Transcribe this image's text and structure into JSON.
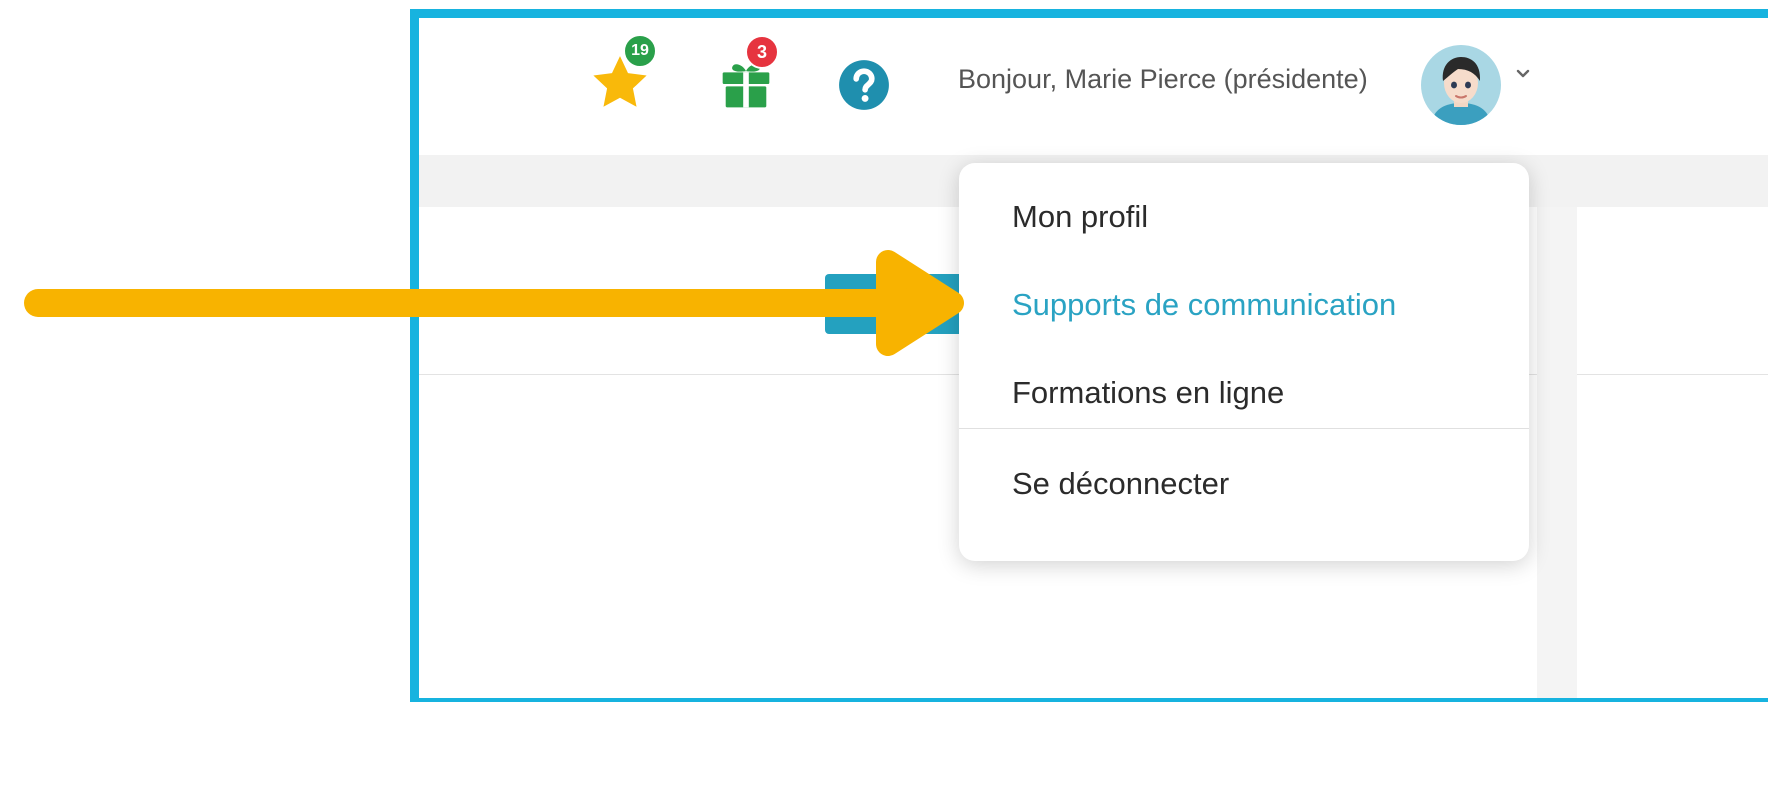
{
  "header": {
    "greeting": "Bonjour, Marie Pierce (présidente)",
    "favorites_count": "19",
    "gifts_count": "3",
    "icons": [
      "star-icon",
      "gift-icon",
      "help-icon",
      "avatar",
      "chevron-down-icon"
    ]
  },
  "user_menu": {
    "items": [
      {
        "label": "Mon profil"
      },
      {
        "label": "Supports de communication",
        "highlighted": true
      },
      {
        "label": "Formations en ligne"
      },
      {
        "label": "Se déconnecter"
      }
    ]
  },
  "colors": {
    "frame_border": "#17b3df",
    "star": "#f9b90a",
    "gift": "#2aa04a",
    "help": "#1f8fae",
    "badge_green": "#2aa04a",
    "badge_red": "#e6343f",
    "menu_highlight": "#2aa3c3",
    "annotation_arrow": "#f8b300"
  }
}
